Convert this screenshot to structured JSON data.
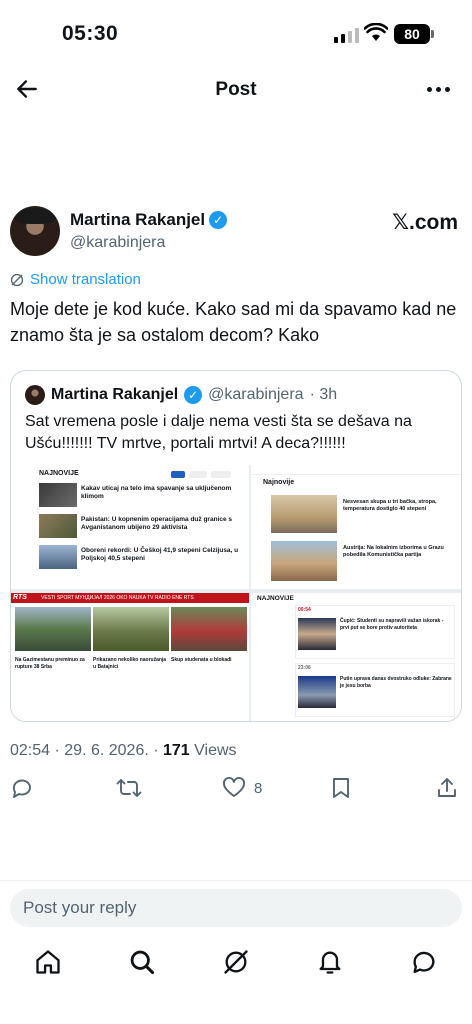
{
  "status": {
    "time": "05:30",
    "battery": "80"
  },
  "nav": {
    "title": "Post"
  },
  "author": {
    "name": "Martina Rakanjel",
    "handle": "@karabinjera",
    "badge": "✓",
    "source": "𝕏.com"
  },
  "translation": {
    "label": "Show translation"
  },
  "tweet": {
    "text": "Moje dete je kod kuće. Kako sad mi da spavamo kad ne znamo šta je sa ostalom decom? Kako"
  },
  "quote": {
    "name": "Martina Rakanjel",
    "handle": "@karabinjera",
    "age": "· 3h",
    "text": "Sat vremena posle i dalje nema vesti šta se dešava na Ušću!!!!!!! TV mrtve, portali mrtvi! A deca?!!!!!!",
    "media": {
      "site1": {
        "title": "NAJNOVIJE",
        "articles": [
          "Kakav uticaj na telo ima spavanje sa uključenom klimom",
          "Pakistan: U kopnenim operacijama duž granice s Avganistanom ubijeno 29 aktivista",
          "Oboreni rekordi: U Češkoj 41,9 stepeni Celzijusa, u Poljskoj 40,5 stepeni"
        ]
      },
      "site2": {
        "title": "Najnovije",
        "articles": [
          "Nesvesan skupa u tri bačka, stropa, temperatura dostiglo 40 stepeni",
          "Austrija: Na lokalnim izborima u Grazu pobedila Komunistička partija"
        ]
      },
      "site3": {
        "nav": "VESTI  SPORT  МУНДИЈАЛ 2026  OKO  NAUKA  TV  RADIO  ENE  RTS",
        "logo": "RTS",
        "cards": [
          "Na Gazimestanu preminuo za rupture 38 Srba",
          "Prikazano nekoliko naoružanja u Batajnici",
          "Skup studenata u blokadi"
        ]
      },
      "site4": {
        "title": "NAJNOVIJE",
        "items": [
          {
            "time": "00:54",
            "text": "Čupić: Studenti su napravili važan iskorak - prvi put se bore protiv autoriteta"
          },
          {
            "time": "23:06",
            "text": "Putin uprava danas dvostruko odluke: Zabrane je jesu borba"
          }
        ]
      }
    }
  },
  "meta": {
    "time": "02:54",
    "date": "29. 6. 2026.",
    "views": "171",
    "views_label": "Views"
  },
  "actions": {
    "likes": "8"
  },
  "reply": {
    "placeholder": "Post your reply"
  },
  "icons": [
    "back-arrow-icon",
    "more-icon",
    "verified-icon",
    "translate-icon",
    "reply-icon",
    "retweet-icon",
    "like-icon",
    "bookmark-icon",
    "share-icon",
    "home-icon",
    "search-icon",
    "grok-icon",
    "notifications-icon",
    "messages-icon"
  ],
  "colors": {
    "accent": "#1d9bf0",
    "text": "#0f1419",
    "secondary": "#536471",
    "rts_red": "#c0141c"
  }
}
